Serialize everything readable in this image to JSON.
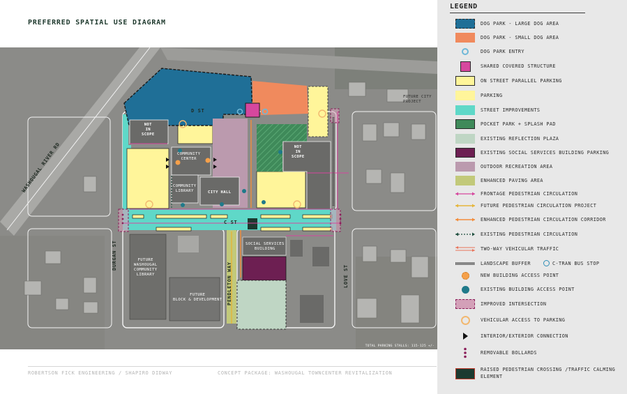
{
  "diagram": {
    "title": "PREFERRED SPATIAL USE DIAGRAM",
    "footer_left": "ROBERTSON FICK ENGINEERING / SHAPIRO DIDWAY",
    "footer_right": "CONCEPT PACKAGE: WASHOUGAL TOWNCENTER REVITALIZATION",
    "total_parking": "TOTAL PARKING STALLS: 115-125 +/-",
    "streets": {
      "d_st": "D ST",
      "c_st": "C ST",
      "durgan_st": "DURGAN ST",
      "pendleton_way": "PENDLETON WAY",
      "love_st": "LOVE ST",
      "washougal_river_rd": "WASHOUGAL RIVER RD"
    },
    "labels": {
      "not_in_scope_1": "NOT\nIN\nSCOPE",
      "not_in_scope_2": "NOT\nIN\nSCOPE",
      "community_center": "COMMUNITY\nCENTER",
      "community_library": "COMMUNITY\nLIBRARY",
      "city_hall": "CITY HALL",
      "social_services_building": "SOCIAL SERVICES\nBUILDING",
      "future_library": "FUTURE\nWASHOUGAL\nCOMMUNITY\nLIBRARY",
      "future_block": "FUTURE\nBLOCK & DEVELOPMENT",
      "future_city_project": "FUTURE CITY\nPROJECT"
    }
  },
  "legend": {
    "title": "LEGEND",
    "items": [
      {
        "label": "DOG PARK - LARGE DOG AREA",
        "color": "#1f6f97"
      },
      {
        "label": "DOG PARK - SMALL DOG AREA",
        "color": "#f08a5d"
      },
      {
        "label": "DOG PARK ENTRY",
        "color": "#6fb8d8"
      },
      {
        "label": "SHARED COVERED STRUCTURE",
        "color": "#d6479e"
      },
      {
        "label": "ON STREET PARALLEL PARKING",
        "color": "#fff59a"
      },
      {
        "label": "PARKING",
        "color": "#fff59a"
      },
      {
        "label": "STREET IMPROVEMENTS",
        "color": "#5fd8c8"
      },
      {
        "label": "POCKET PARK + SPLASH PAD",
        "color": "#3f8a5a"
      },
      {
        "label": "EXISTING REFLECTION PLAZA",
        "color": "#bfd6c4"
      },
      {
        "label": "EXISTING SOCIAL SERVICES BUILDING PARKING",
        "color": "#6d1f52"
      },
      {
        "label": "OUTDOOR RECREATION AREA",
        "color": "#bb9aae"
      },
      {
        "label": "ENHANCED PAVING AREA",
        "color": "#c2c97a"
      },
      {
        "label": "FRONTAGE PEDESTRIAN CIRCULATION",
        "color": "#d6479e"
      },
      {
        "label": "FUTURE PEDESTRIAN CIRCULATION PROJECT",
        "color": "#e5b53a"
      },
      {
        "label": "ENHANCED PEDESTRIAN CIRCULATION CORRIDOR",
        "color": "#f28c3a"
      },
      {
        "label": "EXISTING PEDESTRIAN CIRCULATION",
        "color": "#1f4f3f"
      },
      {
        "label": "TWO-WAY VEHICULAR TRAFFIC",
        "color": "#e8735a"
      },
      {
        "label": "LANDSCAPE BUFFER",
        "color": "#555555"
      },
      {
        "label": "C-TRAN BUS STOP",
        "color": "#2f8fb8"
      },
      {
        "label": "NEW BUILDING ACCESS POINT",
        "color": "#f5a04a"
      },
      {
        "label": "EXISTING BUILDING ACCESS POINT",
        "color": "#1f7a8a"
      },
      {
        "label": "IMPROVED INTERSECTION",
        "color": "#d3a0b8"
      },
      {
        "label": "VEHICULAR ACCESS TO PARKING",
        "color": "#f2b870"
      },
      {
        "label": "INTERIOR/EXTERIOR CONNECTION",
        "color": "#111111"
      },
      {
        "label": "REMOVABLE BOLLARDS",
        "color": "#8b1f5a"
      },
      {
        "label": "RAISED PEDESTRIAN CROSSING /TRAFFIC CALMING ELEMENT",
        "color": "#1c3a30"
      }
    ]
  }
}
